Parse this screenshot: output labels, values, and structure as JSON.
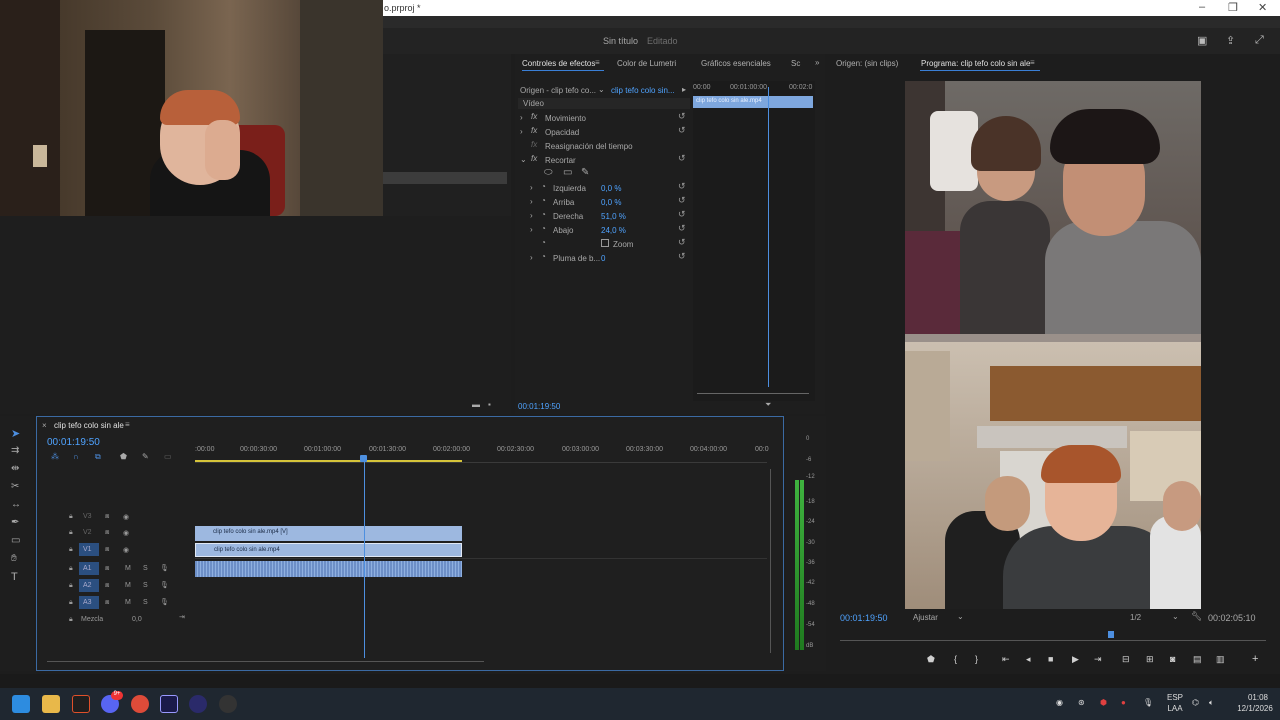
{
  "window": {
    "file_title": "o.prproj *",
    "project_title": "Sin título",
    "project_status": "Editado"
  },
  "effect_panel": {
    "tabs": [
      "Controles de efectos",
      "Color de Lumetri",
      "Gráficos esenciales",
      "Sc"
    ],
    "source_label": "Origen - clip tefo co...",
    "clip_label": "clip tefo colo sin...",
    "section": "Vídeo",
    "effects": [
      {
        "name": "Movimiento"
      },
      {
        "name": "Opacidad"
      },
      {
        "name": "Reasignación del tiempo"
      },
      {
        "name": "Recortar"
      }
    ],
    "crop_params": [
      {
        "name": "Izquierda",
        "value": "0,0 %"
      },
      {
        "name": "Arriba",
        "value": "0,0 %"
      },
      {
        "name": "Derecha",
        "value": "51,0 %"
      },
      {
        "name": "Abajo",
        "value": "24,0 %"
      }
    ],
    "zoom_label": "Zoom",
    "feather_label": "Pluma de b...",
    "feather_value": "0",
    "mini_ruler": [
      "00:00",
      "00:01:00:00",
      "00:02:0"
    ],
    "mini_clip": "clip tefo colo sin ale.mp4",
    "timecode": "00:01:19:50"
  },
  "program_monitor": {
    "tabs": [
      "Origen: (sin clips)",
      "Programa: clip tefo colo sin ale"
    ],
    "current_time": "00:01:19:50",
    "fit": "Ajustar",
    "resolution": "1/2",
    "duration": "00:02:05:10"
  },
  "timeline": {
    "sequence_name": "clip tefo colo sin ale",
    "timecode": "00:01:19:50",
    "ruler": [
      ":00:00",
      "00:00:30:00",
      "00:01:00:00",
      "00:01:30:00",
      "00:02:00:00",
      "00:02:30:00",
      "00:03:00:00",
      "00:03:30:00",
      "00:04:00:00",
      "00:0"
    ],
    "video_tracks": [
      "V3",
      "V2",
      "V1"
    ],
    "audio_tracks": [
      "A1",
      "A2",
      "A3"
    ],
    "mix_label": "Mezcla",
    "mix_value": "0,0",
    "clip_v2": "clip tefo colo sin ale.mp4 [V]",
    "clip_v1": "clip tefo colo sin ale.mp4",
    "meter_scale": [
      "0",
      "-6",
      "-12",
      "-18",
      "-24",
      "-30",
      "-36",
      "-42",
      "-48",
      "-54",
      "dB"
    ]
  },
  "taskbar": {
    "lang": "ESP",
    "lang2": "LAA",
    "time": "01:08",
    "date": "12/1/2026",
    "discord_badge": "9+"
  },
  "colors": {
    "accent": "#3a7fd6",
    "clip_blue": "#9db8e0",
    "value_blue": "#4fa3ff"
  }
}
